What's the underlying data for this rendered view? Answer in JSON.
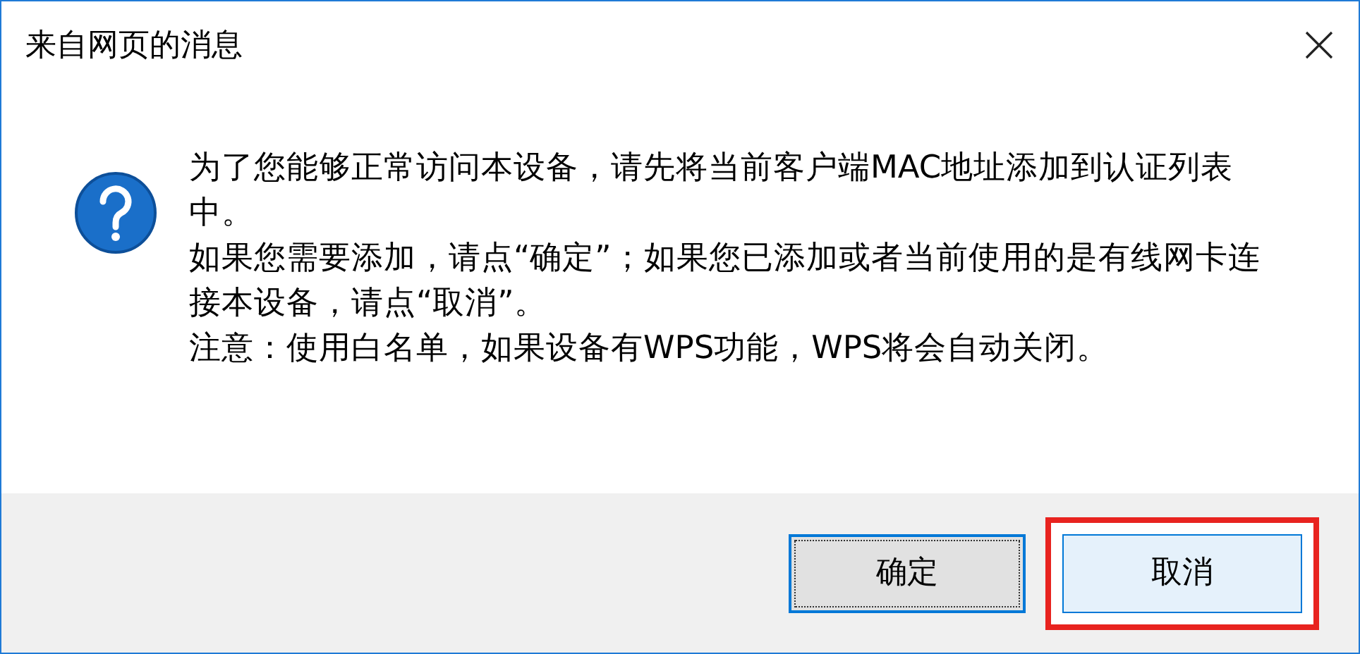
{
  "window": {
    "title": "来自网页的消息"
  },
  "message": {
    "kind": "question",
    "paragraphs": [
      "为了您能够正常访问本设备，请先将当前客户端MAC地址添加到认证列表中。",
      "如果您需要添加，请点“确定”；如果您已添加或者当前使用的是有线网卡连接本设备，请点“取消”。",
      "注意：使用白名单，如果设备有WPS功能，WPS将会自动关闭。"
    ]
  },
  "buttons": [
    {
      "label": "确定",
      "focused": true,
      "highlighted": false
    },
    {
      "label": "取消",
      "focused": false,
      "highlighted": true
    }
  ]
}
